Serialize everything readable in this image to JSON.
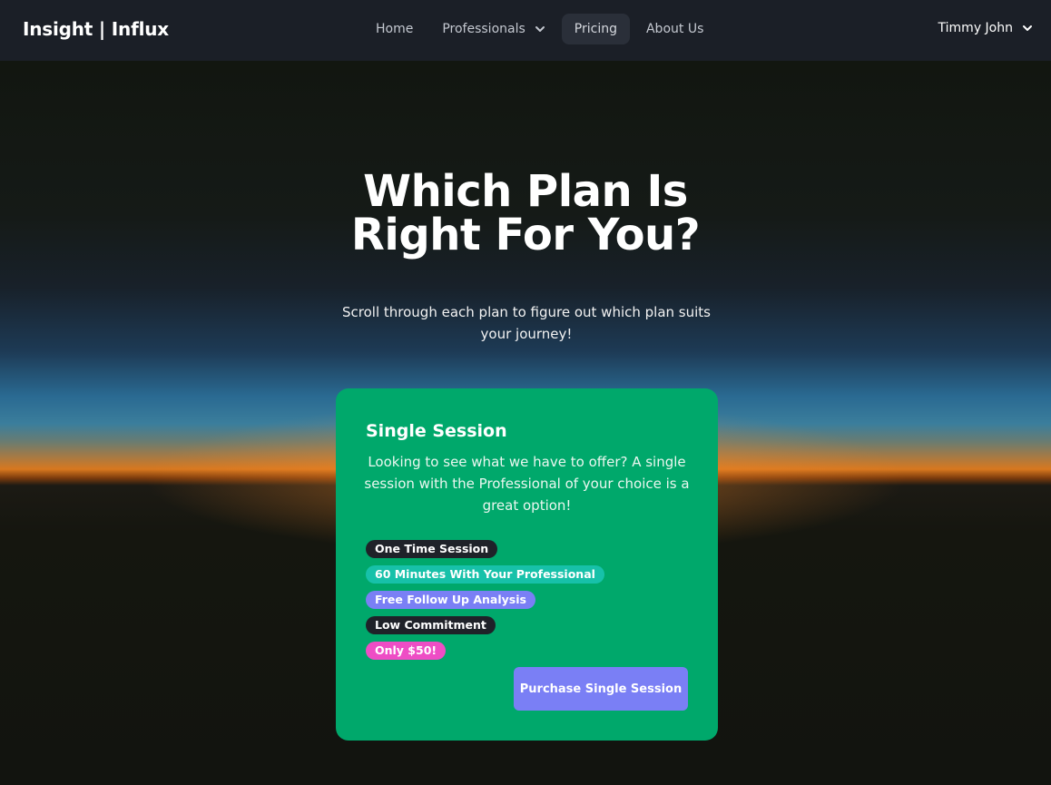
{
  "navbar": {
    "brand": "Insight | Influx",
    "links": [
      {
        "label": "Home",
        "dropdown": false,
        "active": false
      },
      {
        "label": "Professionals",
        "dropdown": true,
        "active": false
      },
      {
        "label": "Pricing",
        "dropdown": false,
        "active": true
      },
      {
        "label": "About Us",
        "dropdown": false,
        "active": false
      }
    ],
    "user": "Timmy John"
  },
  "hero": {
    "title": "Which Plan Is Right For You?",
    "subtitle": "Scroll through each plan to figure out which plan suits your journey!"
  },
  "plan": {
    "name": "Single Session",
    "description": "Looking to see what we have to offer? A single session with the Professional of your choice is a great option!",
    "features": [
      {
        "label": "One Time Session",
        "color": "#1f2229"
      },
      {
        "label": "60 Minutes With Your Professional",
        "color": "#17c1a9"
      },
      {
        "label": "Free Follow Up Analysis",
        "color": "#7a7ff5"
      },
      {
        "label": "Low Commitment",
        "color": "#1f2229"
      },
      {
        "label": "Only $50!",
        "color": "#ee4dc5"
      }
    ],
    "button_label": "Purchase Single Session",
    "card_color": "#00a86b",
    "button_color": "#7a7ff5"
  }
}
